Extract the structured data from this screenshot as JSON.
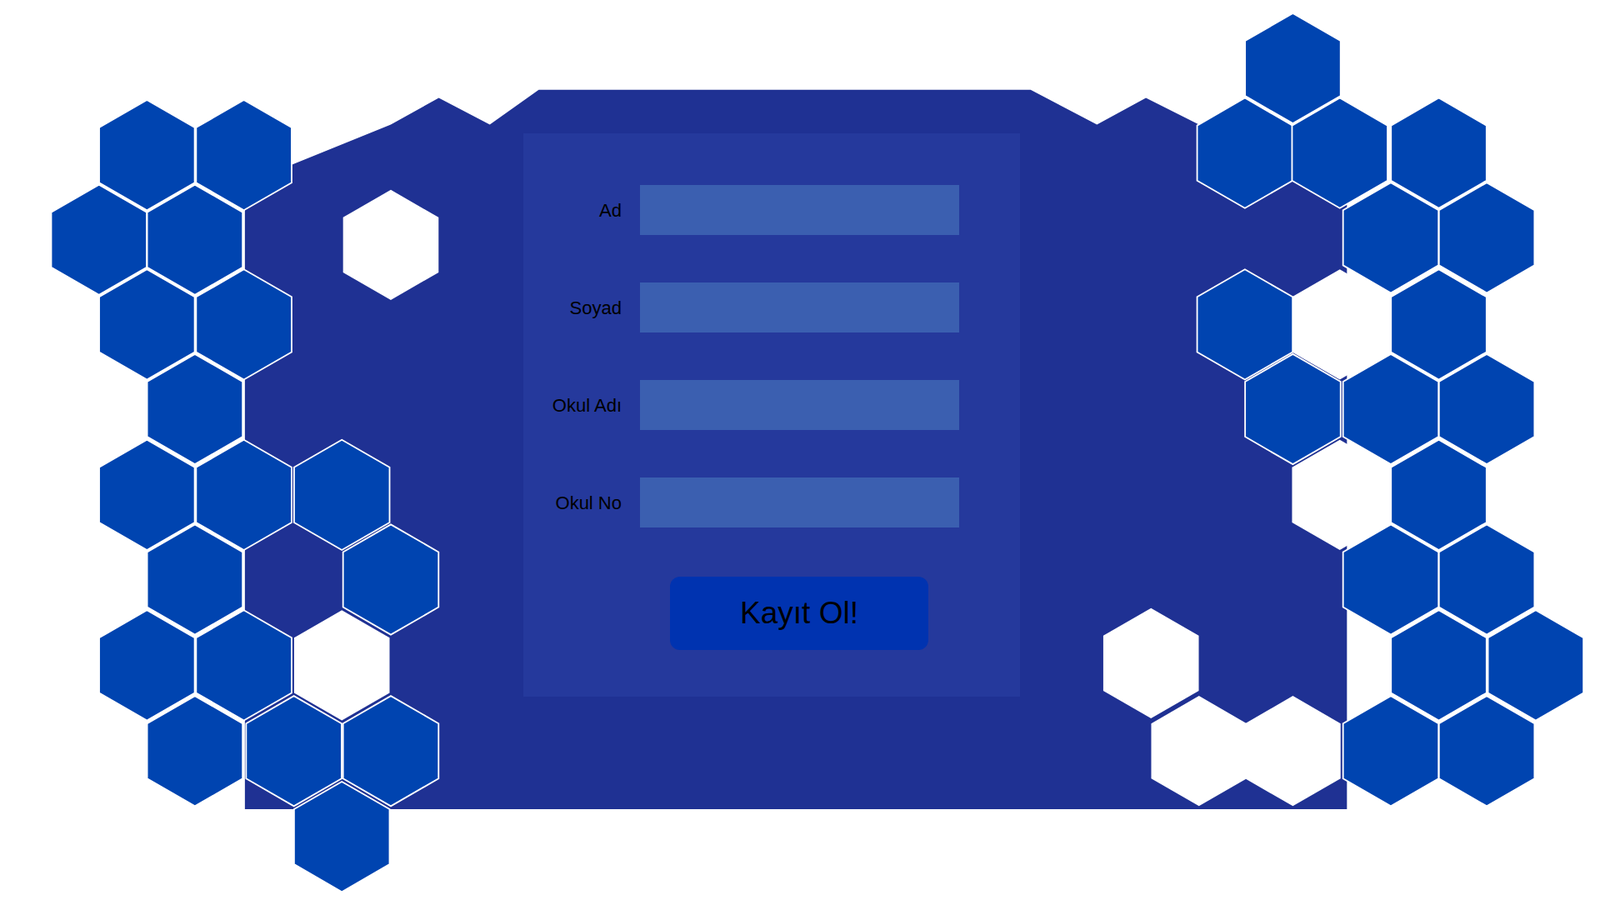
{
  "form": {
    "fields": [
      {
        "label": "Ad"
      },
      {
        "label": "Soyad"
      },
      {
        "label": "Okul Adı"
      },
      {
        "label": "Okul No"
      }
    ],
    "submit": "Kayıt Ol!"
  }
}
